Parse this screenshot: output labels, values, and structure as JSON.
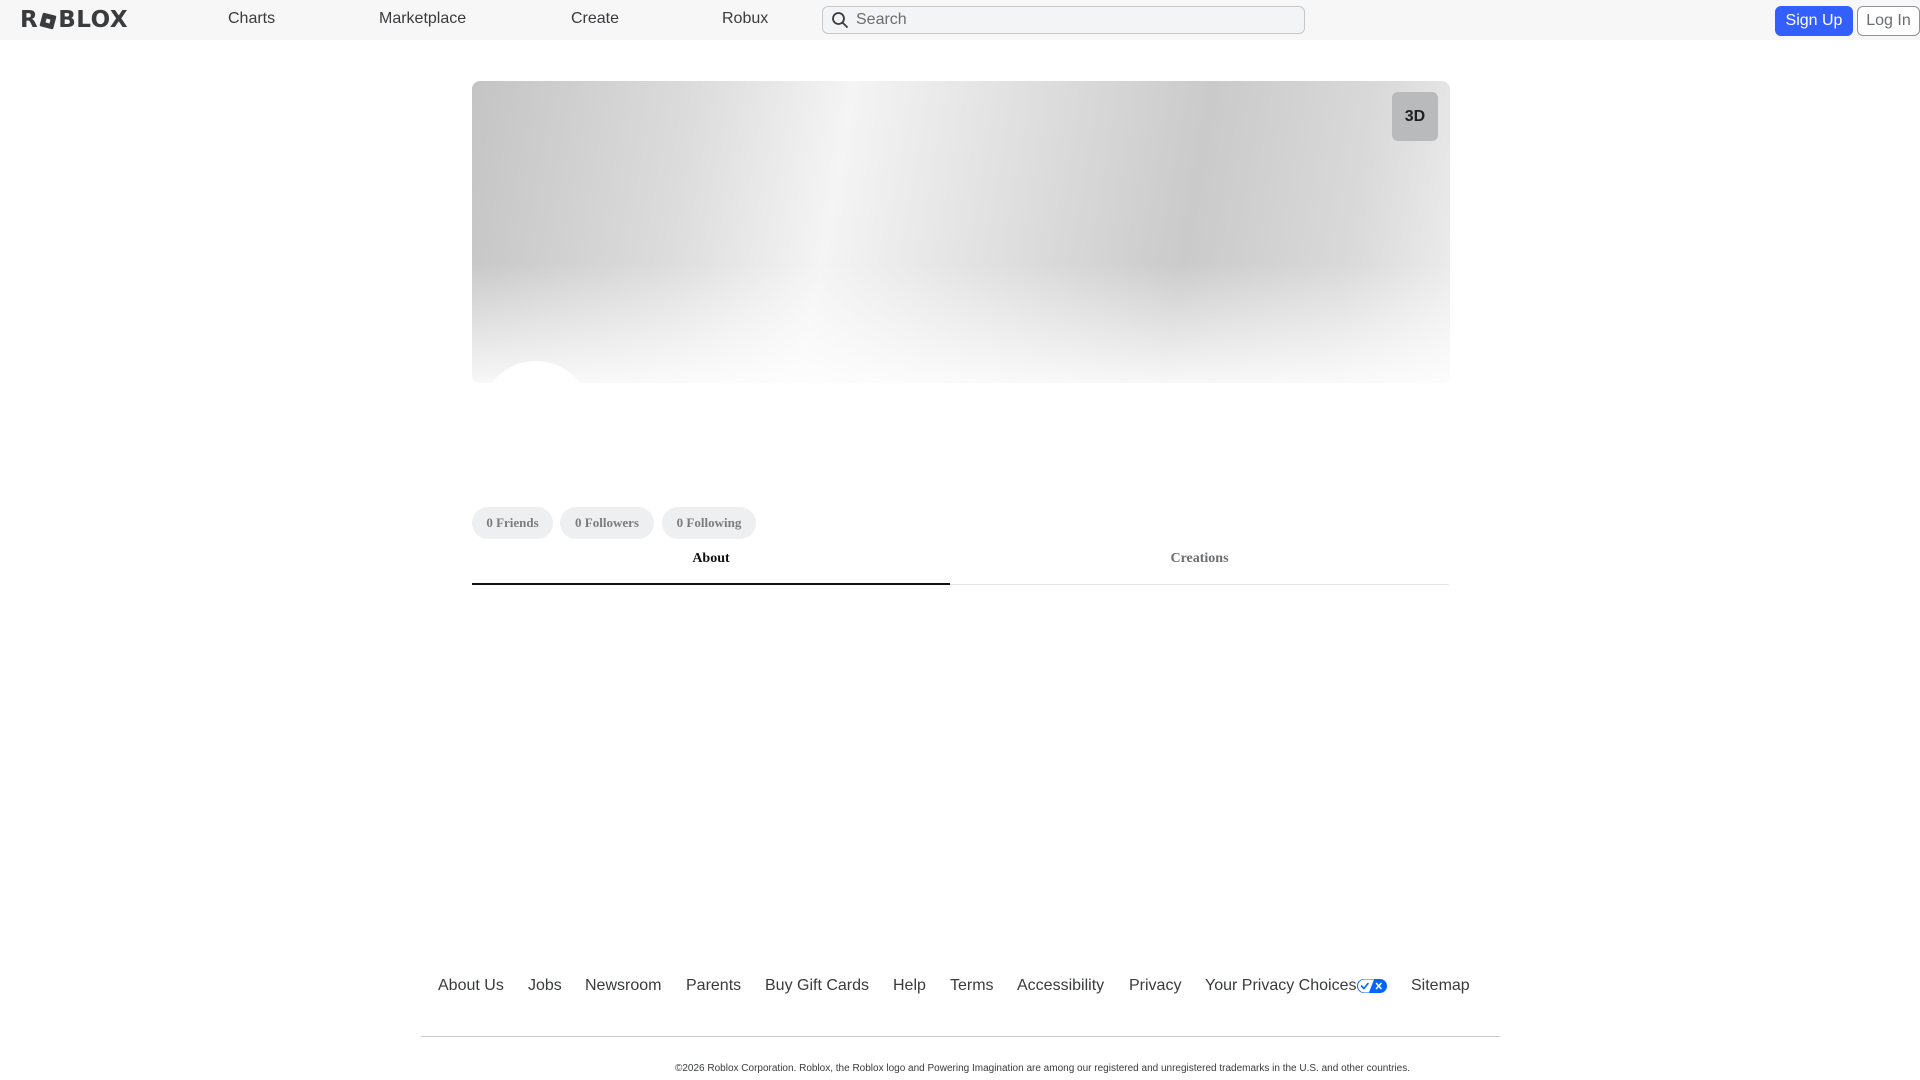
{
  "header": {
    "logo_text_left": "R",
    "logo_text_right": "BLOX",
    "nav": [
      "Charts",
      "Marketplace",
      "Create",
      "Robux"
    ],
    "search_placeholder": "Search",
    "signup_label": "Sign Up",
    "login_label": "Log In"
  },
  "profile": {
    "view_3d_label": "3D",
    "stats": {
      "friends": "0 Friends",
      "followers": "0 Followers",
      "following": "0 Following"
    },
    "tabs": [
      "About",
      "Creations"
    ],
    "active_tab": "About"
  },
  "footer": {
    "links": [
      "About Us",
      "Jobs",
      "Newsroom",
      "Parents",
      "Buy Gift Cards",
      "Help",
      "Terms",
      "Accessibility",
      "Privacy",
      "Your Privacy Choices",
      "Sitemap"
    ],
    "copyright": "©2026 Roblox Corporation. Roblox, the Roblox logo and Powering Imagination are among our registered and unregistered trademarks in the U.S. and other countries."
  },
  "colors": {
    "primary_button": "#335fff",
    "header_bg": "#f7f7f8",
    "text": "#393b3d"
  }
}
